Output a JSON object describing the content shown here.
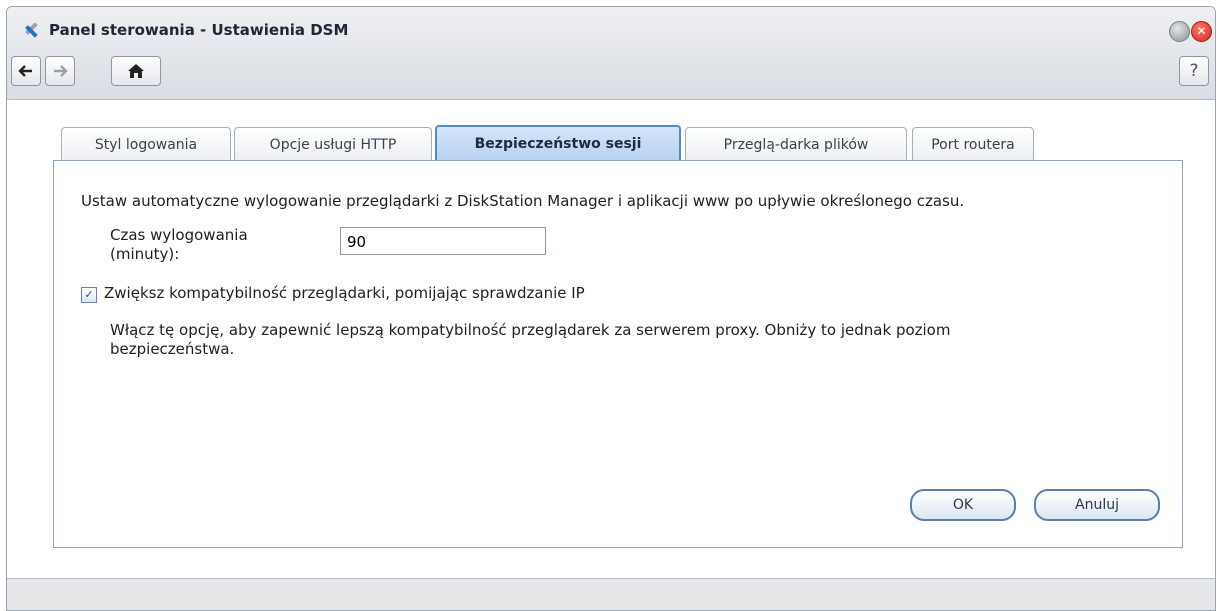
{
  "window": {
    "title": "Panel sterowania - Ustawienia DSM",
    "close_glyph": "✕",
    "help_glyph": "?"
  },
  "icons": {
    "app": "wrench-screwdriver-icon",
    "back": "arrow-left-icon",
    "forward": "arrow-right-icon",
    "home": "home-icon",
    "help": "question-icon"
  },
  "tabs": [
    {
      "label": "Styl logowania",
      "active": false
    },
    {
      "label": "Opcje usługi HTTP",
      "active": false
    },
    {
      "label": "Bezpieczeństwo sesji",
      "active": true
    },
    {
      "label": "Przeglą-darka plików",
      "active": false
    },
    {
      "label": "Port routera",
      "active": false
    }
  ],
  "session": {
    "description": "Ustaw automatyczne wylogowanie przeglądarki z DiskStation Manager i aplikacji www po upływie określonego czasu.",
    "timeout_label_line1": "Czas wylogowania",
    "timeout_label_line2": "(minuty):",
    "timeout_value": "90",
    "checkbox_checked": true,
    "checkbox_label": "Zwiększ kompatybilność przeglądarki, pomijając sprawdzanie IP",
    "help_line1": "Włącz tę opcję, aby zapewnić lepszą kompatybilność przeglądarek za serwerem proxy. Obniży to jednak poziom",
    "help_line2": "bezpieczeństwa."
  },
  "buttons": {
    "ok": "OK",
    "cancel": "Anuluj"
  },
  "colors": {
    "active_tab": "#b6d1f0",
    "close_button": "#d3291a"
  }
}
